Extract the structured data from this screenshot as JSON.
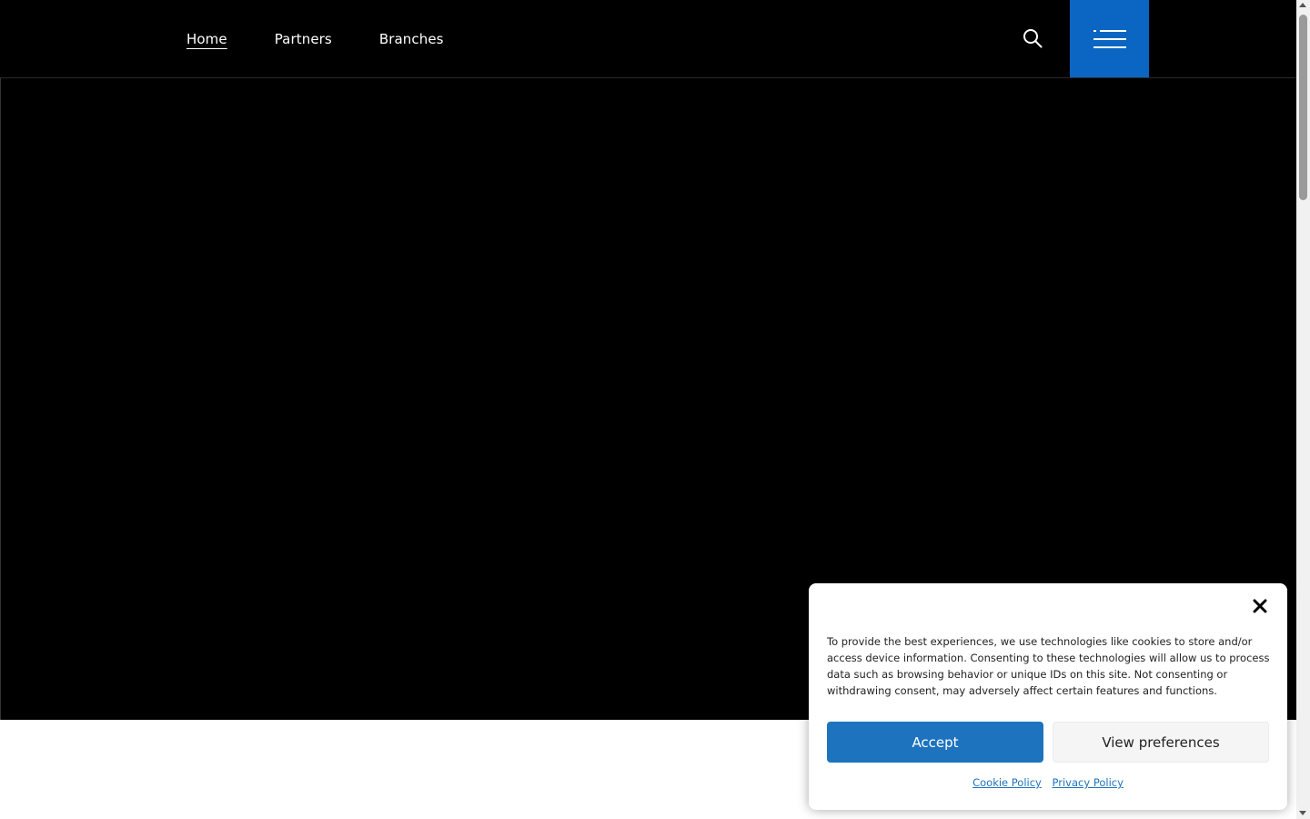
{
  "nav": {
    "items": [
      {
        "label": "Home",
        "active": true
      },
      {
        "label": "Partners",
        "active": false
      },
      {
        "label": "Branches",
        "active": false
      }
    ],
    "search_icon": "search-icon",
    "menu_icon": "hamburger-menu-icon"
  },
  "colors": {
    "header_bg": "#000000",
    "menu_button_bg": "#0a66c2",
    "accept_bg": "#1e73be",
    "link": "#1e73be"
  },
  "cookie_banner": {
    "text": "To provide the best experiences, we use technologies like cookies to store and/or access device information. Consenting to these technologies will allow us to process data such as browsing behavior or unique IDs on this site. Not consenting or withdrawing consent, may adversely affect certain features and functions.",
    "accept_label": "Accept",
    "preferences_label": "View preferences",
    "cookie_policy_label": "Cookie Policy",
    "privacy_policy_label": "Privacy Policy",
    "close_icon": "close-icon"
  }
}
